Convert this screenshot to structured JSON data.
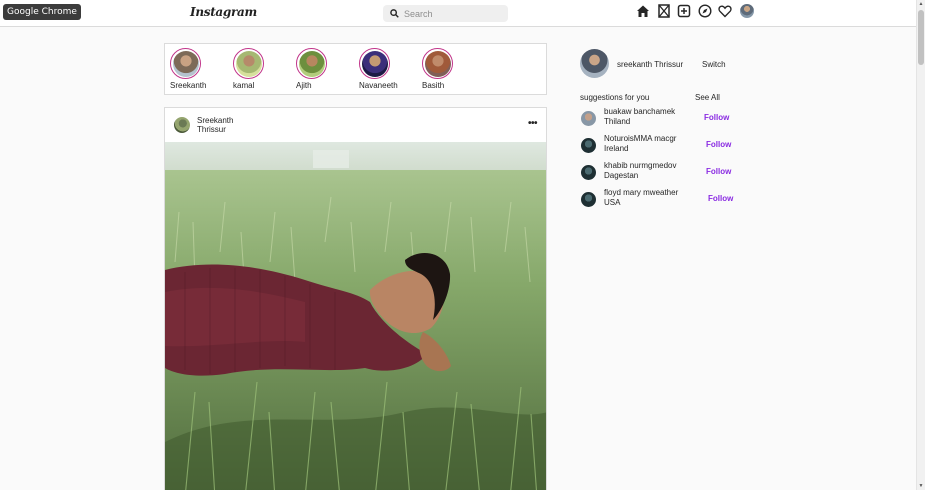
{
  "tooltip": "Google Chrome",
  "header": {
    "logo": "Instagram",
    "search_placeholder": "Search",
    "icons": [
      "home-icon",
      "messenger-icon",
      "new-post-icon",
      "explore-icon",
      "heart-icon",
      "profile-avatar"
    ]
  },
  "stories": [
    {
      "name": "Sreekanth",
      "color": "#7d6a58"
    },
    {
      "name": "kamal",
      "color": "#a6b872"
    },
    {
      "name": "Ajith",
      "color": "#6d8f3e"
    },
    {
      "name": "Navaneeth",
      "color": "#3b2e7a"
    },
    {
      "name": "Basith",
      "color": "#a05a3a"
    }
  ],
  "post": {
    "user": "Sreekanth",
    "location": "Thrissur",
    "more": "•••"
  },
  "sidebar": {
    "profile_name": "sreekanth Thrissur",
    "switch_label": "Switch",
    "suggestions_title": "suggestions for you",
    "see_all": "See All",
    "follow_color": "#8a2be2",
    "suggestions": [
      {
        "name": "buakaw banchamek",
        "location": "Thiland",
        "follow": "Follow"
      },
      {
        "name": "NoturoisMMA macgr",
        "location": "Ireland",
        "follow": "Follow"
      },
      {
        "name": "khabib nurmgmedov",
        "location": "Dagestan",
        "follow": "Follow"
      },
      {
        "name": "floyd mary mweather",
        "location": "USA",
        "follow": "Follow"
      }
    ]
  }
}
